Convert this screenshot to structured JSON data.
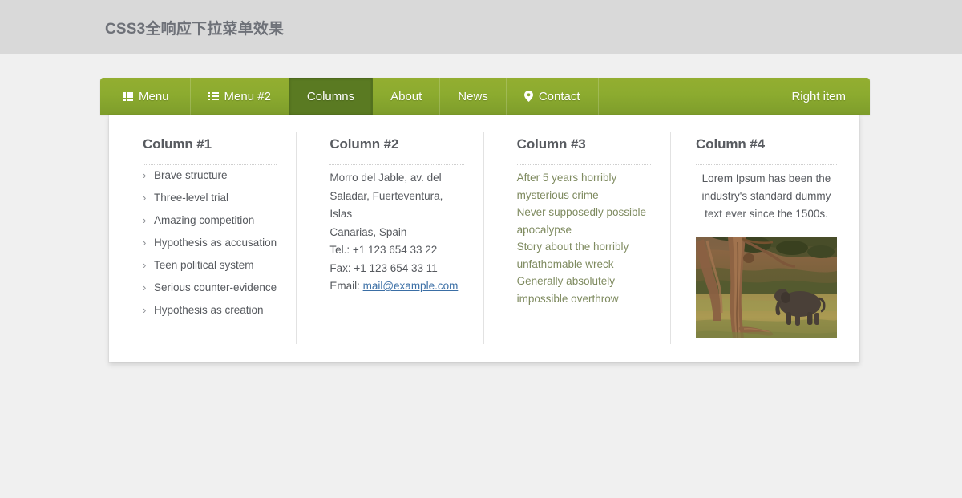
{
  "header": {
    "title": "CSS3全响应下拉菜单效果"
  },
  "navbar": {
    "items": [
      {
        "label": "Menu",
        "icon": "th-list-icon",
        "active": false
      },
      {
        "label": "Menu #2",
        "icon": "list-ul-icon",
        "active": false
      },
      {
        "label": "Columns",
        "icon": "none",
        "active": true
      },
      {
        "label": "About",
        "icon": "none",
        "active": false
      },
      {
        "label": "News",
        "icon": "none",
        "active": false
      },
      {
        "label": "Contact",
        "icon": "map-pin-icon",
        "active": false
      },
      {
        "label": "Right item",
        "icon": "none",
        "active": false
      }
    ]
  },
  "dropdown": {
    "column1": {
      "title": "Column #1",
      "bullet": "›",
      "items": [
        "Brave structure",
        "Three-level trial",
        "Amazing competition",
        "Hypothesis as accusation",
        "Teen political system",
        "Serious counter-evidence",
        "Hypothesis as creation"
      ]
    },
    "column2": {
      "title": "Column #2",
      "address_line1": "Morro del Jable, av. del",
      "address_line2": "Saladar, Fuerteventura, Islas",
      "address_line3": "Canarias, Spain",
      "tel": "Tel.: +1 123 654 33 22",
      "fax": "Fax: +1 123 654 33 11",
      "email_label": "Email: ",
      "email_value": "mail@example.com"
    },
    "column3": {
      "title": "Column #3",
      "items": [
        "After 5 years horribly",
        "mysterious crime",
        "Never supposedly possible",
        "apocalypse",
        "Story about the horribly",
        "unfathomable wreck",
        "Generally absolutely",
        "impossible overthrow"
      ]
    },
    "column4": {
      "title": "Column #4",
      "text": "Lorem Ipsum has been the industry's standard dummy text ever since the 1500s.",
      "image_alt": "elephant-walking-near-tree-photo"
    }
  },
  "colors": {
    "nav_green_top": "#93ae31",
    "nav_green_bottom": "#7e9d2b",
    "nav_active": "#5a7a22",
    "header_bar": "#d9d9d9",
    "page_background": "#f0f0f0",
    "panel": "#ffffff",
    "text_dark": "#56595e",
    "link_blue": "#3a6ea5",
    "link_olive": "#7e8a5f"
  }
}
